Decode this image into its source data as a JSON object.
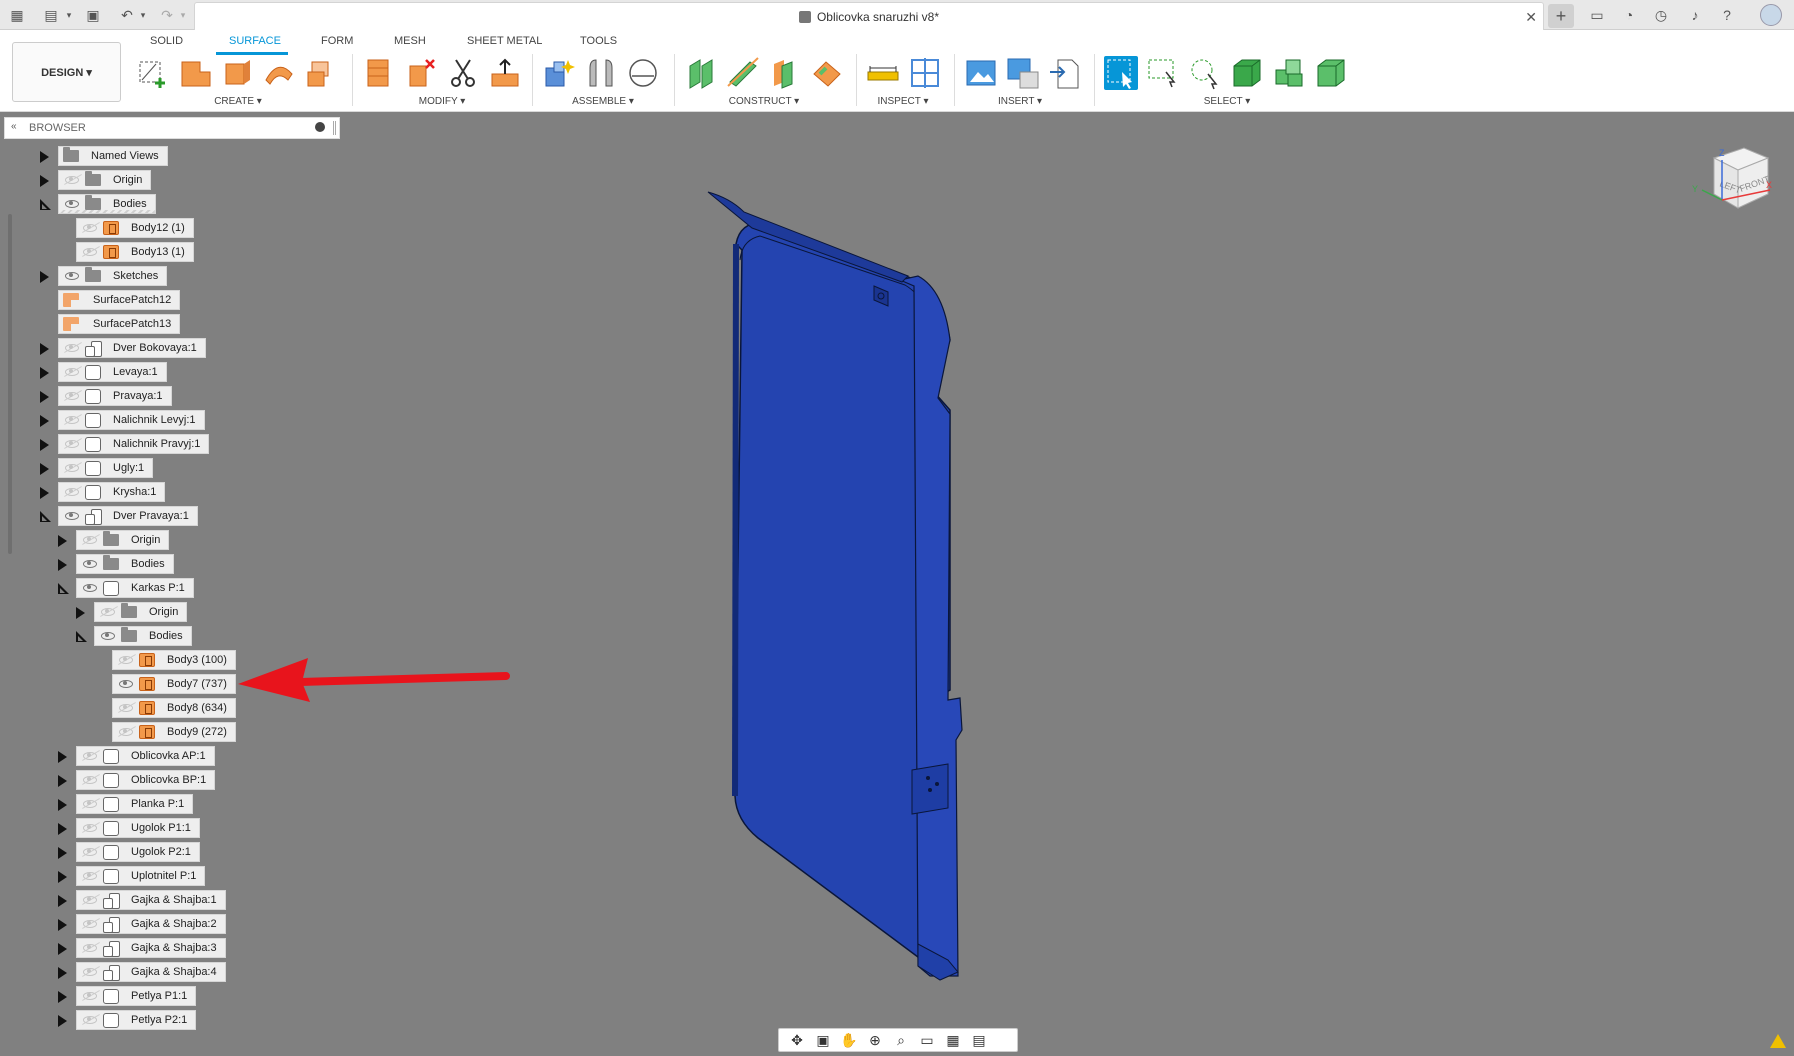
{
  "window": {
    "title": "Oblicovka snaruzhi v8*",
    "icons": [
      "grid-icon",
      "file-icon",
      "save-icon",
      "undo-icon",
      "redo-icon",
      "close-icon",
      "new-tab-icon",
      "notification-icon",
      "job-status-icon",
      "history-icon",
      "bell-icon",
      "help-icon",
      "avatar"
    ]
  },
  "toolbar": {
    "workspace_label": "DESIGN ▾",
    "tabs": [
      {
        "label": "SOLID"
      },
      {
        "label": "SURFACE",
        "active": true
      },
      {
        "label": "FORM"
      },
      {
        "label": "MESH"
      },
      {
        "label": "SHEET METAL"
      },
      {
        "label": "TOOLS"
      }
    ],
    "groups": [
      {
        "label": "CREATE ▾"
      },
      {
        "label": "MODIFY ▾"
      },
      {
        "label": "ASSEMBLE ▾"
      },
      {
        "label": "CONSTRUCT ▾"
      },
      {
        "label": "INSPECT ▾"
      },
      {
        "label": "INSERT ▾"
      },
      {
        "label": "SELECT ▾"
      }
    ],
    "accent_color": "#0696d7"
  },
  "browser": {
    "title": "BROWSER",
    "collapse_icon": "«",
    "items": [
      {
        "label": "Named Views",
        "icon": "folder",
        "expander": "right",
        "eye": "none"
      },
      {
        "label": "Origin",
        "icon": "folder",
        "expander": "right",
        "eye": "off"
      },
      {
        "label": "Bodies",
        "icon": "folder",
        "expander": "down",
        "eye": "on"
      },
      {
        "label": "Body12 (1)",
        "icon": "body",
        "expander": "none",
        "eye": "off"
      },
      {
        "label": "Body13 (1)",
        "icon": "body",
        "expander": "none",
        "eye": "off"
      },
      {
        "label": "Sketches",
        "icon": "folder",
        "expander": "right",
        "eye": "on"
      },
      {
        "label": "SurfacePatch12",
        "icon": "patch",
        "expander": "none",
        "eye": "none"
      },
      {
        "label": "SurfacePatch13",
        "icon": "patch",
        "expander": "none",
        "eye": "none"
      },
      {
        "label": "Dver Bokovaya:1",
        "icon": "comp2",
        "expander": "right",
        "eye": "off"
      },
      {
        "label": "Levaya:1",
        "icon": "comp",
        "expander": "right",
        "eye": "off"
      },
      {
        "label": "Pravaya:1",
        "icon": "comp",
        "expander": "right",
        "eye": "off"
      },
      {
        "label": "Nalichnik Levyj:1",
        "icon": "comp",
        "expander": "right",
        "eye": "off"
      },
      {
        "label": "Nalichnik Pravyj:1",
        "icon": "comp",
        "expander": "right",
        "eye": "off"
      },
      {
        "label": "Ugly:1",
        "icon": "comp",
        "expander": "right",
        "eye": "off"
      },
      {
        "label": "Krysha:1",
        "icon": "comp",
        "expander": "right",
        "eye": "off"
      },
      {
        "label": "Dver Pravaya:1",
        "icon": "comp2",
        "expander": "down",
        "eye": "on"
      },
      {
        "label": "Origin",
        "icon": "folder",
        "expander": "right",
        "eye": "off"
      },
      {
        "label": "Bodies",
        "icon": "folder",
        "expander": "right",
        "eye": "on"
      },
      {
        "label": "Karkas P:1",
        "icon": "comp",
        "expander": "down",
        "eye": "on"
      },
      {
        "label": "Origin",
        "icon": "folder",
        "expander": "right",
        "eye": "off"
      },
      {
        "label": "Bodies",
        "icon": "folder",
        "expander": "down",
        "eye": "on"
      },
      {
        "label": "Body3 (100)",
        "icon": "body",
        "expander": "none",
        "eye": "off"
      },
      {
        "label": "Body7 (737)",
        "icon": "body",
        "expander": "none",
        "eye": "on"
      },
      {
        "label": "Body8 (634)",
        "icon": "body",
        "expander": "none",
        "eye": "off"
      },
      {
        "label": "Body9 (272)",
        "icon": "body",
        "expander": "none",
        "eye": "off"
      },
      {
        "label": "Oblicovka AP:1",
        "icon": "comp",
        "expander": "right",
        "eye": "off"
      },
      {
        "label": "Oblicovka BP:1",
        "icon": "comp",
        "expander": "right",
        "eye": "off"
      },
      {
        "label": "Planka P:1",
        "icon": "comp",
        "expander": "right",
        "eye": "off"
      },
      {
        "label": "Ugolok P1:1",
        "icon": "comp",
        "expander": "right",
        "eye": "off"
      },
      {
        "label": "Ugolok P2:1",
        "icon": "comp",
        "expander": "right",
        "eye": "off"
      },
      {
        "label": "Uplotnitel P:1",
        "icon": "comp",
        "expander": "right",
        "eye": "off"
      },
      {
        "label": "Gajka & Shajba:1",
        "icon": "comp2",
        "expander": "right",
        "eye": "off"
      },
      {
        "label": "Gajka & Shajba:2",
        "icon": "comp2",
        "expander": "right",
        "eye": "off"
      },
      {
        "label": "Gajka & Shajba:3",
        "icon": "comp2",
        "expander": "right",
        "eye": "off"
      },
      {
        "label": "Gajka & Shajba:4",
        "icon": "comp2",
        "expander": "right",
        "eye": "off"
      },
      {
        "label": "Petlya P1:1",
        "icon": "comp",
        "expander": "right",
        "eye": "off"
      },
      {
        "label": "Petlya P2:1",
        "icon": "comp",
        "expander": "right",
        "eye": "off"
      }
    ]
  },
  "viewport": {
    "background": "#808080",
    "model_color": "#2040a8",
    "annotation_arrow_color": "#e8141c"
  },
  "viewcube": {
    "faces": [
      "LEFT",
      "FRONT"
    ],
    "axes": [
      "X",
      "Y",
      "Z"
    ]
  },
  "navbar": {
    "icons": [
      "orbit-icon",
      "look-at-icon",
      "pan-icon",
      "zoom-icon",
      "zoom-window-icon",
      "display-settings-icon",
      "grid-icon",
      "viewports-icon"
    ]
  }
}
